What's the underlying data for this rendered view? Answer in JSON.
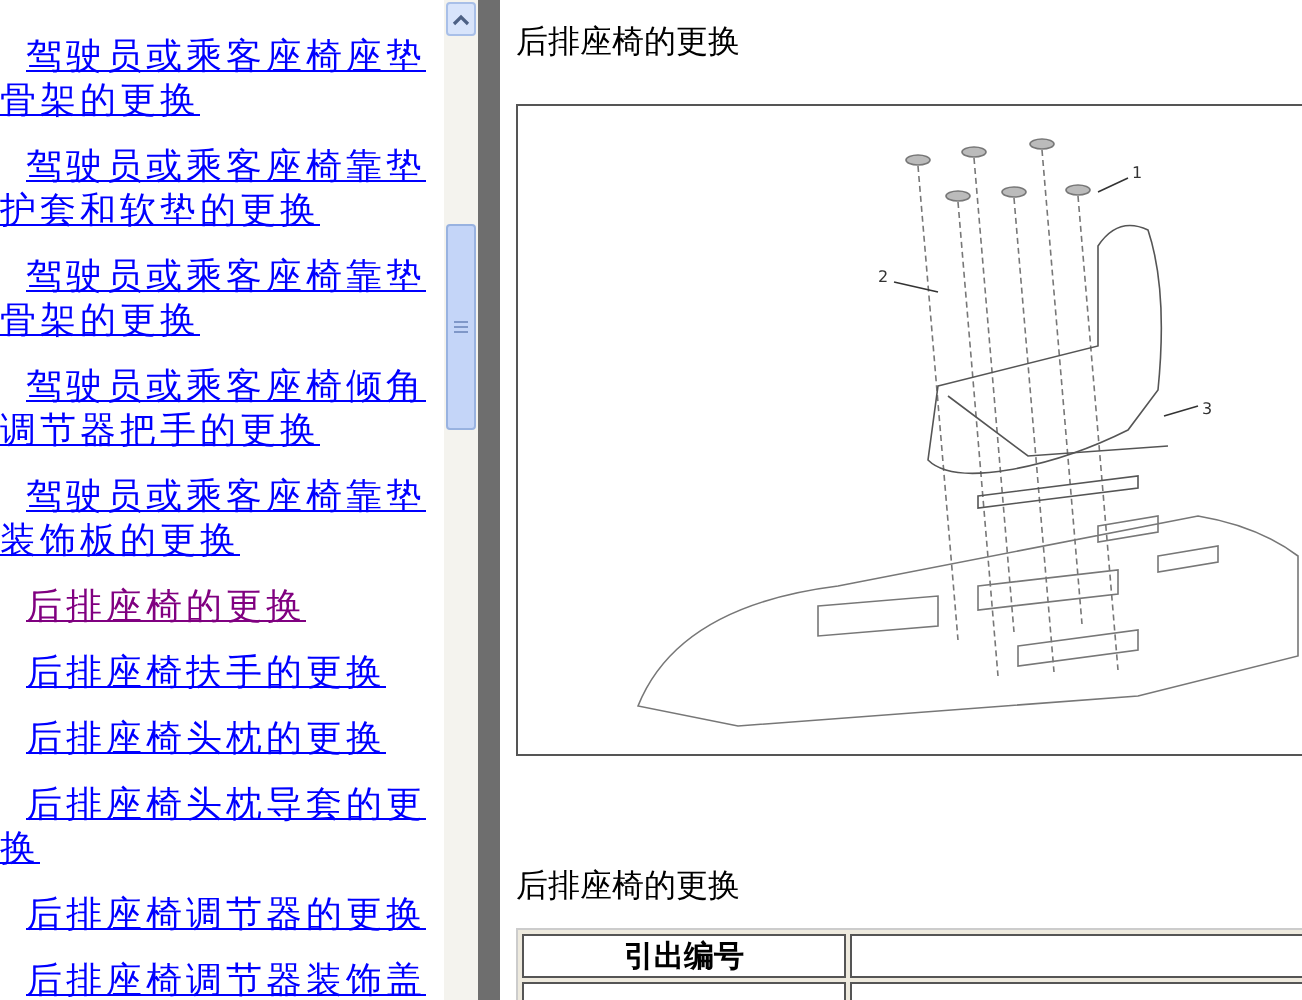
{
  "nav_links": [
    {
      "label": "驾驶员或乘客座椅座垫骨架的更换",
      "selected": false
    },
    {
      "label": "驾驶员或乘客座椅靠垫护套和软垫的更换",
      "selected": false
    },
    {
      "label": "驾驶员或乘客座椅靠垫骨架的更换",
      "selected": false
    },
    {
      "label": "驾驶员或乘客座椅倾角调节器把手的更换",
      "selected": false
    },
    {
      "label": "驾驶员或乘客座椅靠垫装饰板的更换",
      "selected": false
    },
    {
      "label": "后排座椅的更换",
      "selected": true
    },
    {
      "label": "后排座椅扶手的更换",
      "selected": false
    },
    {
      "label": "后排座椅头枕的更换",
      "selected": false
    },
    {
      "label": "后排座椅头枕导套的更换",
      "selected": false
    },
    {
      "label": "后排座椅调节器的更换",
      "selected": false
    },
    {
      "label": "后排座椅调节器装饰盖",
      "selected": false
    }
  ],
  "content": {
    "title": "后排座椅的更换",
    "figure": {
      "callouts": [
        "1",
        "2",
        "3"
      ]
    },
    "section_heading": "后排座椅的更换",
    "table": {
      "columns": [
        "引出编号"
      ]
    }
  }
}
